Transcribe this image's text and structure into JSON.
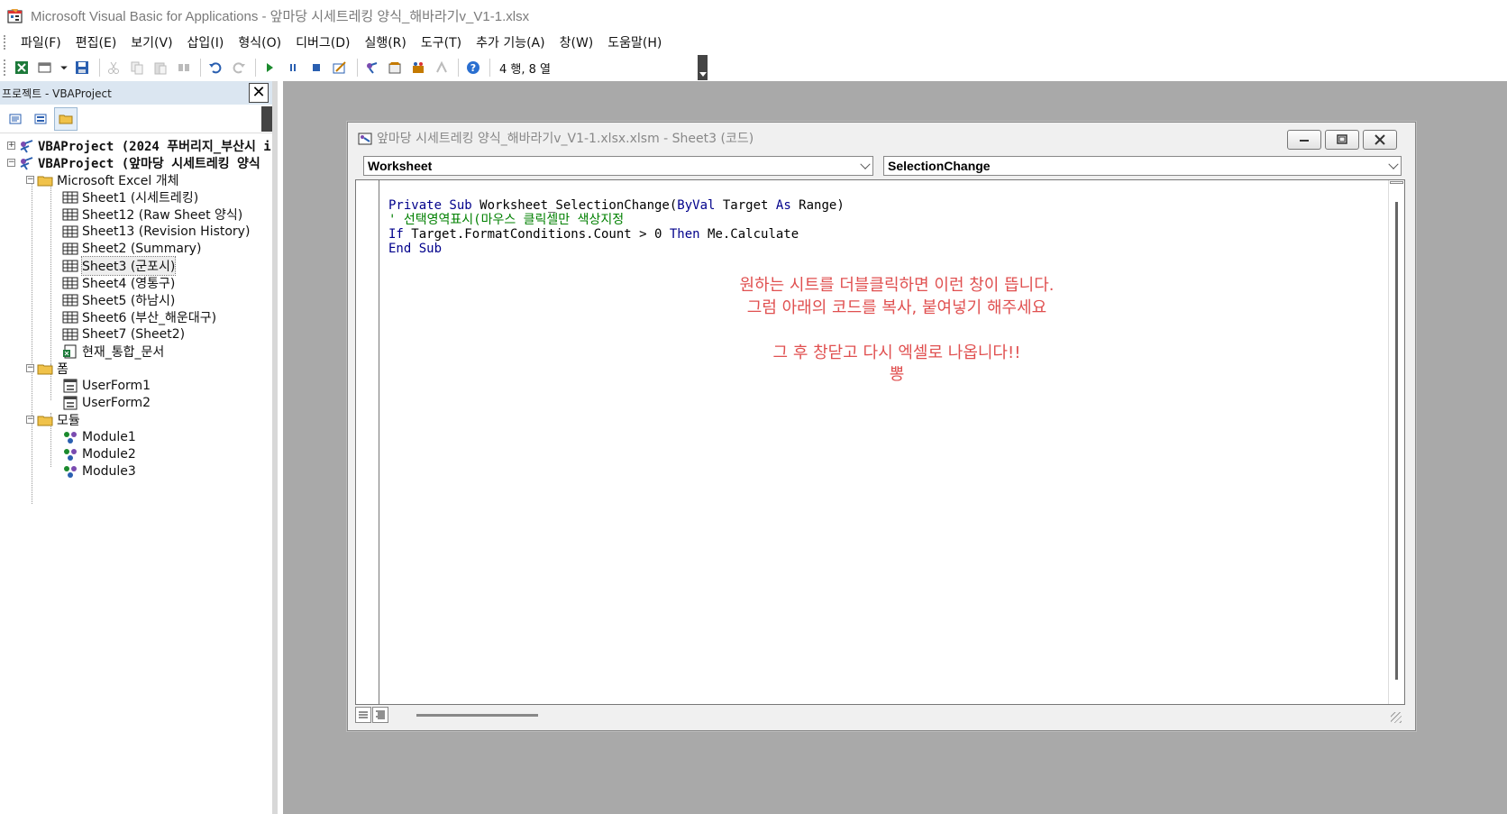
{
  "window": {
    "title": "Microsoft Visual Basic for Applications - 앞마당 시세트레킹 양식_해바라기v_V1-1.xlsx"
  },
  "menu": {
    "items": [
      "파일(F)",
      "편집(E)",
      "보기(V)",
      "삽입(I)",
      "형식(O)",
      "디버그(D)",
      "실행(R)",
      "도구(T)",
      "추가 기능(A)",
      "창(W)",
      "도움말(H)"
    ]
  },
  "toolbar": {
    "position_readout": "4 행, 8 열",
    "icons": [
      "excel-icon",
      "insert-module-icon",
      "save-icon",
      "cut-icon",
      "copy-icon",
      "paste-icon",
      "find-icon",
      "undo-icon",
      "redo-icon",
      "run-icon",
      "break-icon",
      "reset-icon",
      "design-mode-icon",
      "project-explorer-icon",
      "properties-icon",
      "object-browser-icon",
      "toolbox-icon",
      "help-icon"
    ]
  },
  "project": {
    "header": "프로젝트 - VBAProject",
    "tree": {
      "projects": [
        "VBAProject (2024 푸버리지_부산시 i",
        "VBAProject (앞마당 시세트레킹 양식"
      ],
      "excel_objects_folder": "Microsoft Excel 개체",
      "sheets": [
        "Sheet1 (시세트레킹)",
        "Sheet12 (Raw Sheet 양식)",
        "Sheet13 (Revision History)",
        "Sheet2 (Summary)",
        "Sheet3 (군포시)",
        "Sheet4 (영통구)",
        "Sheet5 (하남시)",
        "Sheet6 (부산_해운대구)",
        "Sheet7 (Sheet2)"
      ],
      "workbook": "현재_통합_문서",
      "forms_folder": "폼",
      "forms": [
        "UserForm1",
        "UserForm2"
      ],
      "modules_folder": "모듈",
      "modules": [
        "Module1",
        "Module2",
        "Module3"
      ]
    }
  },
  "code_window": {
    "title": "앞마당 시세트레킹 양식_해바라기v_V1-1.xlsx.xlsm - Sheet3 (코드)",
    "object_combo": "Worksheet",
    "procedure_combo": "SelectionChange",
    "code": {
      "line1_kw1": "Private Sub",
      "line1_rest_a": " Worksheet_SelectionChange(",
      "line1_kw2": "ByVal",
      "line1_rest_b": " Target ",
      "line1_kw3": "As",
      "line1_rest_c": " Range)",
      "line2_comment": "' 선택영역표시(마우스 클릭셀만 색상지정",
      "line3_kw1": "If",
      "line3_rest_a": " Target.FormatConditions.Count > 0 ",
      "line3_kw2": "Then",
      "line3_rest_b": " Me.Calculate",
      "line4_kw": "End Sub"
    },
    "annotation": {
      "line1": "원하는 시트를 더블클릭하면 이런 창이 뜹니다.",
      "line2": "그럼 아래의 코드를 복사, 붙여넣기 해주세요",
      "line3": "그 후 창닫고 다시 엑셀로 나옵니다!!",
      "line4": "뽕"
    },
    "annotation_color": "#e05050"
  }
}
